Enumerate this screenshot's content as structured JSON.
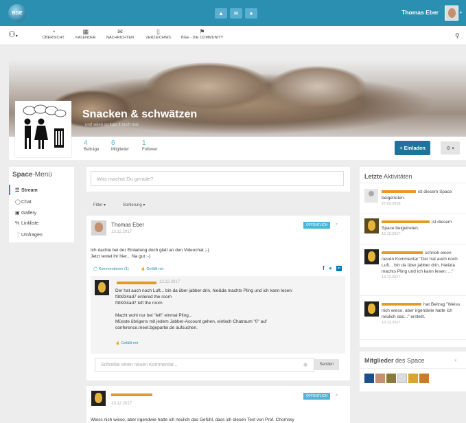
{
  "topbar": {
    "logo": "BGE",
    "user_name": "Thomas Eber",
    "icons": [
      "bell-icon",
      "envelope-icon",
      "chat-icon"
    ]
  },
  "nav": {
    "items": [
      {
        "label": "Übersicht",
        "icon": "dashboard-icon"
      },
      {
        "label": "Kalender",
        "icon": "calendar-icon"
      },
      {
        "label": "Nachrichten",
        "icon": "envelope-icon"
      },
      {
        "label": "Verzeichnis",
        "icon": "book-icon"
      },
      {
        "label": "BGE - die Community",
        "icon": "megaphone-icon"
      }
    ]
  },
  "space": {
    "title": "Snacken & schwätzen",
    "subtitle": "und seien so kurz it auch mal",
    "stats": [
      {
        "value": "4",
        "label": "Beiträge"
      },
      {
        "value": "6",
        "label": "Mitglieder"
      },
      {
        "value": "1",
        "label": "Follower"
      }
    ],
    "invite_label": "+ Einladen",
    "settings_label": "⚙ ▾"
  },
  "menu": {
    "title_strong": "Space",
    "title_rest": "-Menü",
    "items": [
      "Stream",
      "Chat",
      "Gallery",
      "Linkliste",
      "Umfragen"
    ]
  },
  "composer": {
    "placeholder": "Was machst Du gerade?"
  },
  "filters": {
    "filter": "Filter ▾",
    "sort": "Sortierung ▾"
  },
  "post1": {
    "author": "Thomas Eber",
    "date": "13.12.2017",
    "badge": "Öffentlich",
    "text1": "Ich dachte bei der Einladung doch glatt an den Videochat ;-)",
    "text2": "Jetzt textet ihr hier... Na gut :-)",
    "comments_link": "Kommentieren (1)",
    "like": "Gefällt mir",
    "comment": {
      "date": "13.12.2017",
      "lines": [
        "Der hat auch noch Luft... bin da über jabber drin, hie&da machts Pling und ich kann lesen:",
        "f3b934ad7 entered the room",
        "f3b934ad7 left the room",
        "",
        "Macht wohl nur bei \"left\" einmal Pling...",
        "Müsste übrigens mit jedem Jabber-Account gehen, einfach Chatraum \"0\" auf",
        "conference.meet.bgepartei.de aufsuchen."
      ],
      "like": "Gefällt mir"
    },
    "new_comment_placeholder": "Schreibe einen neuen Kommentar...",
    "send": "Senden"
  },
  "post2": {
    "date": "13.12.2017",
    "badge": "Öffentlich",
    "text": "Weiss nich wieso, aber irgendwie hatte ich neulich das Gefühl, dass ich diesen Text von Prof. Chomsky"
  },
  "activities": {
    "title_strong": "Letzte",
    "title_rest": " Aktivitäten",
    "items": [
      {
        "text": "ist diesem Space beigetreten.",
        "date": "27.02.2018"
      },
      {
        "text": "ist diesem Space beigetreten.",
        "date": "15.12.2017"
      },
      {
        "text": "schrieb einen neuen Kommentar \"Der hat auch noch Luft... bin da über jabber drin, hie&da machts Pling und ich kann lesen: ...\"",
        "date": "13.12.2017"
      },
      {
        "text": "hat Beitrag \"Weiss nich wieso, aber irgendwie hatte ich neulich das...\" erstellt.",
        "date": "13.12.2017"
      }
    ]
  },
  "members": {
    "title_strong": "Mitglieder",
    "title_rest": " des Space"
  },
  "colors": {
    "primary": "#2a8fb1",
    "accent": "#4fb6d8",
    "invite": "#20739a",
    "redacted": "#e49a2b"
  }
}
